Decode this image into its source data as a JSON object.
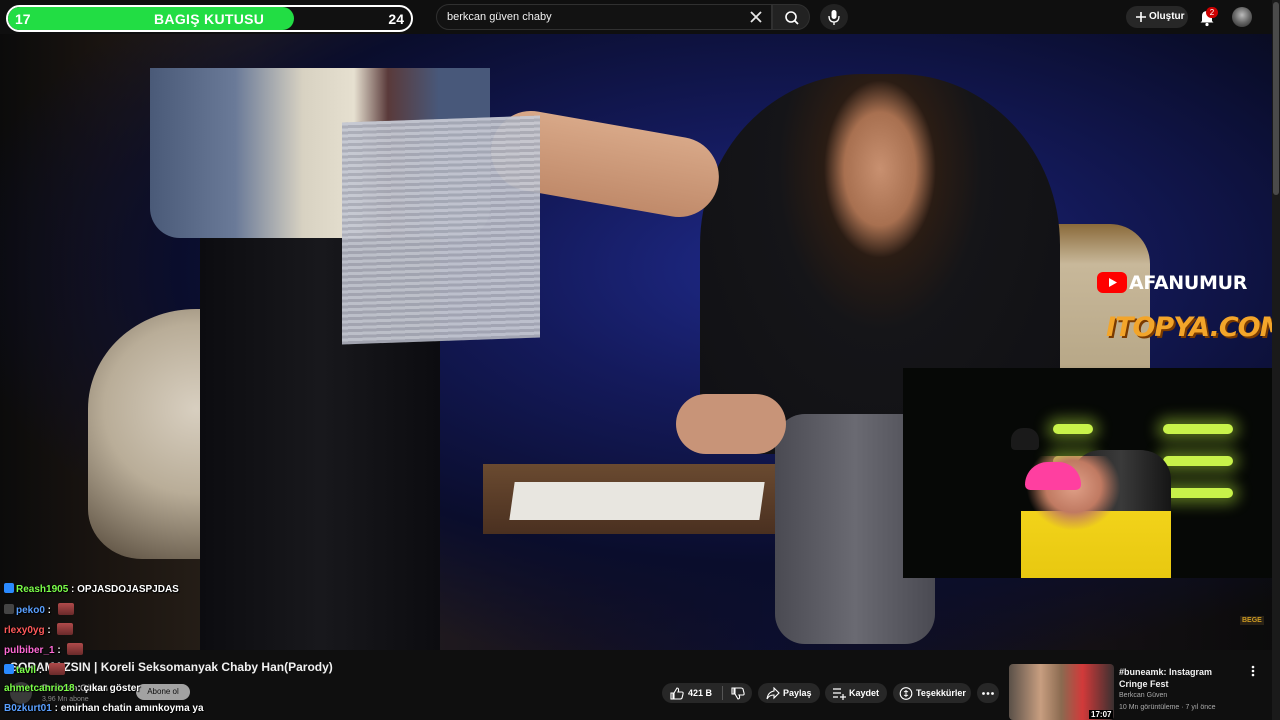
{
  "donation_bar": {
    "left_value": "17",
    "title": "BAGIŞ KUTUSU",
    "right_value": "24",
    "progress": 0.71,
    "fill_color": "#22dd44"
  },
  "search": {
    "query": "berkcan güven chaby",
    "clear_icon": "close-icon",
    "search_icon": "search-icon",
    "mic_icon": "mic-icon"
  },
  "header": {
    "create_label": "Oluştur",
    "notification_count": "2"
  },
  "overlay": {
    "brand_name": "AFANUMUR",
    "sponsor": "ITOPYA.COM",
    "corner_tag": "BEGE"
  },
  "video": {
    "title": "SORAMAZSIN | Koreli Seksomanyak Chaby Han(Parody)",
    "channel": "Berkcan Güven",
    "subscribers": "3,96 Mn abone",
    "subscribe_label": "Abone ol",
    "actions": {
      "like_count": "421 B",
      "share": "Paylaş",
      "save": "Kaydet",
      "thanks": "Teşekkürler"
    }
  },
  "related": {
    "title": "#buneamk: Instagram Cringe Fest",
    "channel": "Berkcan Güven",
    "meta": "10 Mn görüntüleme · 7 yıl önce",
    "duration": "17:07"
  },
  "chat": [
    {
      "user": "Reash1905",
      "message": "OPJASDOJASPJDAS",
      "color": "#7cff4a",
      "badge_color": "#2a8aff"
    },
    {
      "user": "peko0",
      "message": "",
      "color": "#5aa0ff",
      "badge_color": "#444444",
      "emote": true
    },
    {
      "user": "rlexy0yg",
      "message": "",
      "color": "#ff5a5a",
      "badge_color": "",
      "emote": true
    },
    {
      "user": "pulbiber_1",
      "message": "",
      "color": "#ff6ad5",
      "badge_color": "",
      "emote": true
    },
    {
      "user": "tavil",
      "message": "",
      "color": "#7cff4a",
      "badge_color": "#2a8aff",
      "emote": true
    },
    {
      "user": "ahmetcanrio18",
      "message": "çıkar göster",
      "color": "#7cff4a",
      "badge_color": "",
      "emote": false
    },
    {
      "user": "B0zkurt01",
      "message": "emirhan chatin amınkoyma ya",
      "color": "#5aa0ff",
      "badge_color": "",
      "emote": false
    }
  ]
}
